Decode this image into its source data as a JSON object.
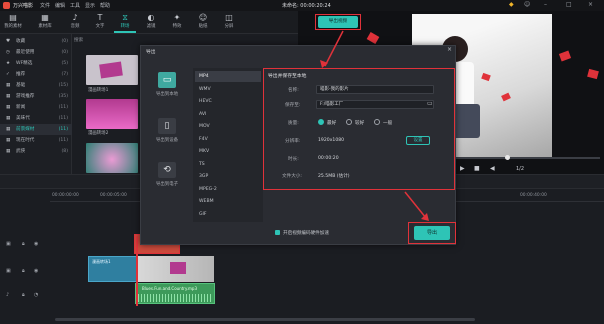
{
  "app": {
    "title": "万兴喵影",
    "project_time": "未命名: 00:00:20:24"
  },
  "menu": [
    "文件",
    "编辑",
    "工具",
    "显示",
    "帮助"
  ],
  "toolbar": [
    {
      "label": "我的素材",
      "icon": "folder-icon"
    },
    {
      "label": "素材库",
      "icon": "library-icon"
    },
    {
      "label": "音频",
      "icon": "music-icon"
    },
    {
      "label": "文字",
      "icon": "text-icon"
    },
    {
      "label": "转场",
      "icon": "transition-icon",
      "active": true
    },
    {
      "label": "滤镜",
      "icon": "filter-icon"
    },
    {
      "label": "特效",
      "icon": "effects-icon"
    },
    {
      "label": "贴纸",
      "icon": "sticker-icon"
    },
    {
      "label": "分屏",
      "icon": "split-screen-icon"
    }
  ],
  "sidebar": [
    {
      "label": "收藏",
      "count": "(0)"
    },
    {
      "label": "最近使用",
      "count": "(0)"
    },
    {
      "label": "WF精选",
      "count": "(5)"
    },
    {
      "label": "推荐",
      "count": "(7)"
    },
    {
      "label": "基础",
      "count": "(15)"
    },
    {
      "label": "游戏推荐",
      "count": "(35)"
    },
    {
      "label": "新闻",
      "count": "(11)"
    },
    {
      "label": "美味代",
      "count": "(11)"
    },
    {
      "label": "前景媒材",
      "count": "(11)",
      "active": true
    },
    {
      "label": "现在时代",
      "count": "(11)"
    },
    {
      "label": "武侠",
      "count": "(8)"
    }
  ],
  "media": {
    "thumbs": [
      {
        "label": "漫画转场1",
        "color": "#c9c3cc"
      },
      {
        "label": "漫画转场2",
        "color": "#b23a8f"
      },
      {
        "label": "漫画转场3",
        "color": "#7ec9b8"
      }
    ],
    "search_placeholder": "搜索"
  },
  "preview": {
    "export_top": "导出视频",
    "page": "1/2"
  },
  "dialog": {
    "title": "导出",
    "close": "×",
    "left": [
      {
        "label": "导出到本地",
        "icon": "monitor-icon",
        "active": true
      },
      {
        "label": "导出到设备",
        "icon": "phone-icon"
      },
      {
        "label": "导出到电子",
        "icon": "share-icon"
      }
    ],
    "formats": [
      "MP4",
      "WMV",
      "HEVC",
      "AVI",
      "MOV",
      "F4V",
      "MKV",
      "TS",
      "3GP",
      "MPEG-2",
      "WEBM",
      "GIF"
    ],
    "settings_title": "导出并保存至本地",
    "name_label": "名称:",
    "name_value": "喵影-我的影片",
    "save_label": "保存至:",
    "save_value": "F:/喵影工厂",
    "quality_label": "质量:",
    "q1": "最好",
    "q2": "较好",
    "q3": "一般",
    "res_label": "分辨率:",
    "res_value": "1920x1080",
    "settings_btn": "设置",
    "dur_label": "时长:",
    "dur_value": "00:00:20",
    "size_label": "文件大小:",
    "size_value": "25.5MB (估计)",
    "hw_label": "开启视频编码硬件加速",
    "export_btn": "导出"
  },
  "timeline": {
    "ruler1": "00:00:00:00",
    "ruler2": "00:00:05:00",
    "ruler3": "00:00:40:00",
    "clip1": "漫画转场1",
    "audio": "Blues.Fun.and.Country.mp3"
  },
  "colors": {
    "accent": "#2ec4b6",
    "highlight": "#e0323a"
  }
}
